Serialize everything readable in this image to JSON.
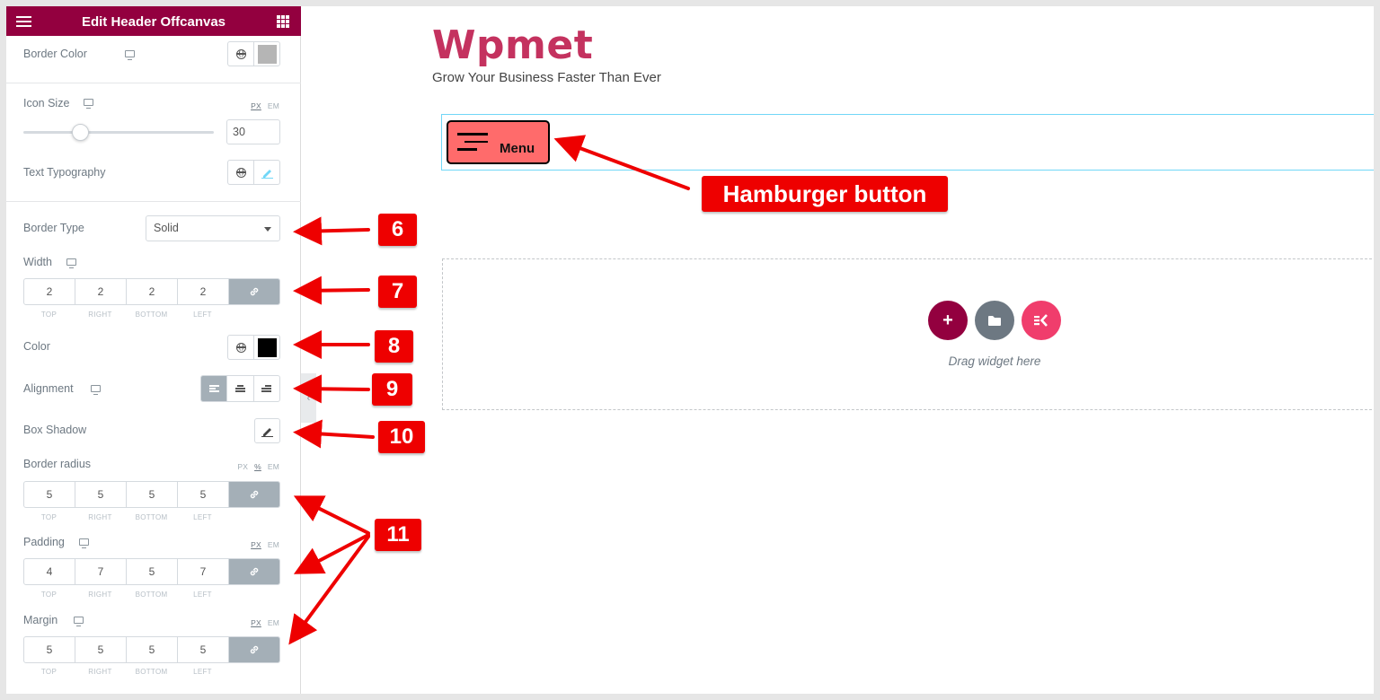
{
  "panel": {
    "title": "Edit Header Offcanvas",
    "border_color_label": "Border Color",
    "border_color_swatch": "#b5b5b5",
    "icon_size_label": "Icon Size",
    "icon_size_units": [
      "PX",
      "EM"
    ],
    "icon_size_value": "30",
    "icon_size_slider_fraction": 0.3,
    "text_typography_label": "Text Typography",
    "border_type_label": "Border Type",
    "border_type_value": "Solid",
    "width_label": "Width",
    "width_values": [
      "2",
      "2",
      "2",
      "2"
    ],
    "side_labels": [
      "TOP",
      "RIGHT",
      "BOTTOM",
      "LEFT"
    ],
    "color_label": "Color",
    "color_swatch": "#000000",
    "alignment_label": "Alignment",
    "box_shadow_label": "Box Shadow",
    "border_radius_label": "Border radius",
    "border_radius_units": [
      "PX",
      "%",
      "EM"
    ],
    "border_radius_values": [
      "5",
      "5",
      "5",
      "5"
    ],
    "padding_label": "Padding",
    "padding_units": [
      "PX",
      "EM"
    ],
    "padding_values": [
      "4",
      "7",
      "5",
      "7"
    ],
    "margin_label": "Margin",
    "margin_units": [
      "PX",
      "EM"
    ],
    "margin_values": [
      "5",
      "5",
      "5",
      "5"
    ]
  },
  "canvas": {
    "brand": "Wpmet",
    "tagline": "Grow Your Business Faster Than Ever",
    "menu_button_label": "Menu",
    "drop_text": "Drag widget here",
    "add_icon": "+"
  },
  "annotations": {
    "hamburger_label": "Hamburger button",
    "n6": "6",
    "n7": "7",
    "n8": "8",
    "n9": "9",
    "n10": "10",
    "n11": "11"
  },
  "colors": {
    "panel_header": "#93003f",
    "brand": "#c4325f",
    "menu_button_bg": "#ff6b6b",
    "annotation_red": "#ee0000",
    "add_button": "#93003f",
    "template_button": "#6d7882",
    "ek_button": "#f03d6c"
  }
}
